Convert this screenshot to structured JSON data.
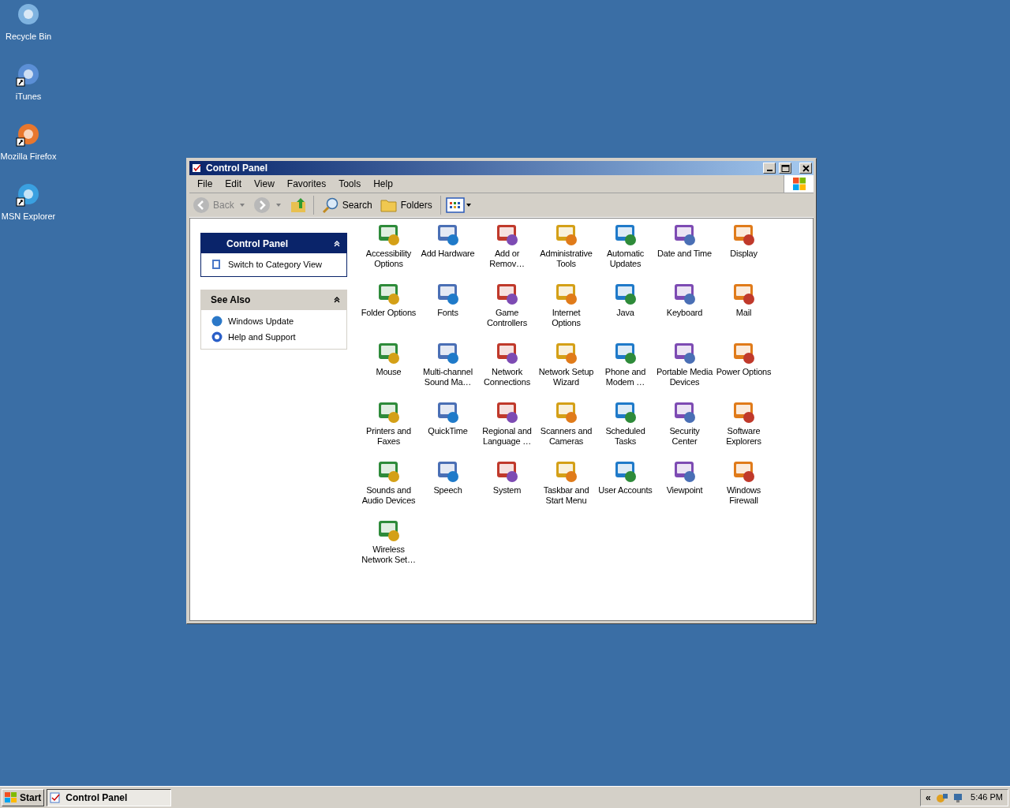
{
  "desktop_icons": [
    {
      "label": "Recycle Bin",
      "shortcut": false
    },
    {
      "label": "iTunes",
      "shortcut": true
    },
    {
      "label": "Mozilla Firefox",
      "shortcut": true
    },
    {
      "label": "MSN Explorer",
      "shortcut": true
    }
  ],
  "window": {
    "title": "Control Panel"
  },
  "menu": [
    "File",
    "Edit",
    "View",
    "Favorites",
    "Tools",
    "Help"
  ],
  "toolbar": {
    "back": {
      "label": "Back",
      "disabled": true
    },
    "search": "Search",
    "folders": "Folders"
  },
  "task_panes": [
    {
      "title": "Control Panel",
      "kind": "primary",
      "links": [
        "Switch to Category View"
      ]
    },
    {
      "title": "See Also",
      "kind": "secondary",
      "links": [
        "Windows Update",
        "Help and Support"
      ]
    }
  ],
  "applets": [
    {
      "lines": [
        "Accessibility",
        "Options"
      ]
    },
    {
      "lines": [
        "Add Hardware"
      ]
    },
    {
      "lines": [
        "Add or",
        "Remov…"
      ]
    },
    {
      "lines": [
        "Administrative",
        "Tools"
      ]
    },
    {
      "lines": [
        "Automatic",
        "Updates"
      ]
    },
    {
      "lines": [
        "Date and Time"
      ]
    },
    {
      "lines": [
        "Display"
      ]
    },
    {
      "lines": [
        "Folder Options"
      ]
    },
    {
      "lines": [
        "Fonts"
      ]
    },
    {
      "lines": [
        "Game",
        "Controllers"
      ]
    },
    {
      "lines": [
        "Internet",
        "Options"
      ]
    },
    {
      "lines": [
        "Java"
      ]
    },
    {
      "lines": [
        "Keyboard"
      ]
    },
    {
      "lines": [
        "Mail"
      ]
    },
    {
      "lines": [
        "Mouse"
      ]
    },
    {
      "lines": [
        "Multi-channel",
        "Sound Ma…"
      ]
    },
    {
      "lines": [
        "Network",
        "Connections"
      ]
    },
    {
      "lines": [
        "Network Setup",
        "Wizard"
      ]
    },
    {
      "lines": [
        "Phone and",
        "Modem …"
      ]
    },
    {
      "lines": [
        "Portable Media",
        "Devices"
      ]
    },
    {
      "lines": [
        "Power Options"
      ]
    },
    {
      "lines": [
        "Printers and",
        "Faxes"
      ]
    },
    {
      "lines": [
        "QuickTime"
      ]
    },
    {
      "lines": [
        "Regional and",
        "Language …"
      ]
    },
    {
      "lines": [
        "Scanners and",
        "Cameras"
      ]
    },
    {
      "lines": [
        "Scheduled",
        "Tasks"
      ]
    },
    {
      "lines": [
        "Security",
        "Center"
      ]
    },
    {
      "lines": [
        "Software",
        "Explorers"
      ]
    },
    {
      "lines": [
        "Sounds and",
        "Audio Devices"
      ]
    },
    {
      "lines": [
        "Speech"
      ]
    },
    {
      "lines": [
        "System"
      ]
    },
    {
      "lines": [
        "Taskbar and",
        "Start Menu"
      ]
    },
    {
      "lines": [
        "User Accounts"
      ]
    },
    {
      "lines": [
        "Viewpoint"
      ]
    },
    {
      "lines": [
        "Windows",
        "Firewall"
      ]
    },
    {
      "lines": [
        "Wireless",
        "Network Set…"
      ]
    }
  ],
  "taskbar": {
    "start": "Start",
    "tasks": [
      {
        "label": "Control Panel",
        "selected": true
      }
    ],
    "tray_expand": "«",
    "clock": "5:46 PM"
  }
}
